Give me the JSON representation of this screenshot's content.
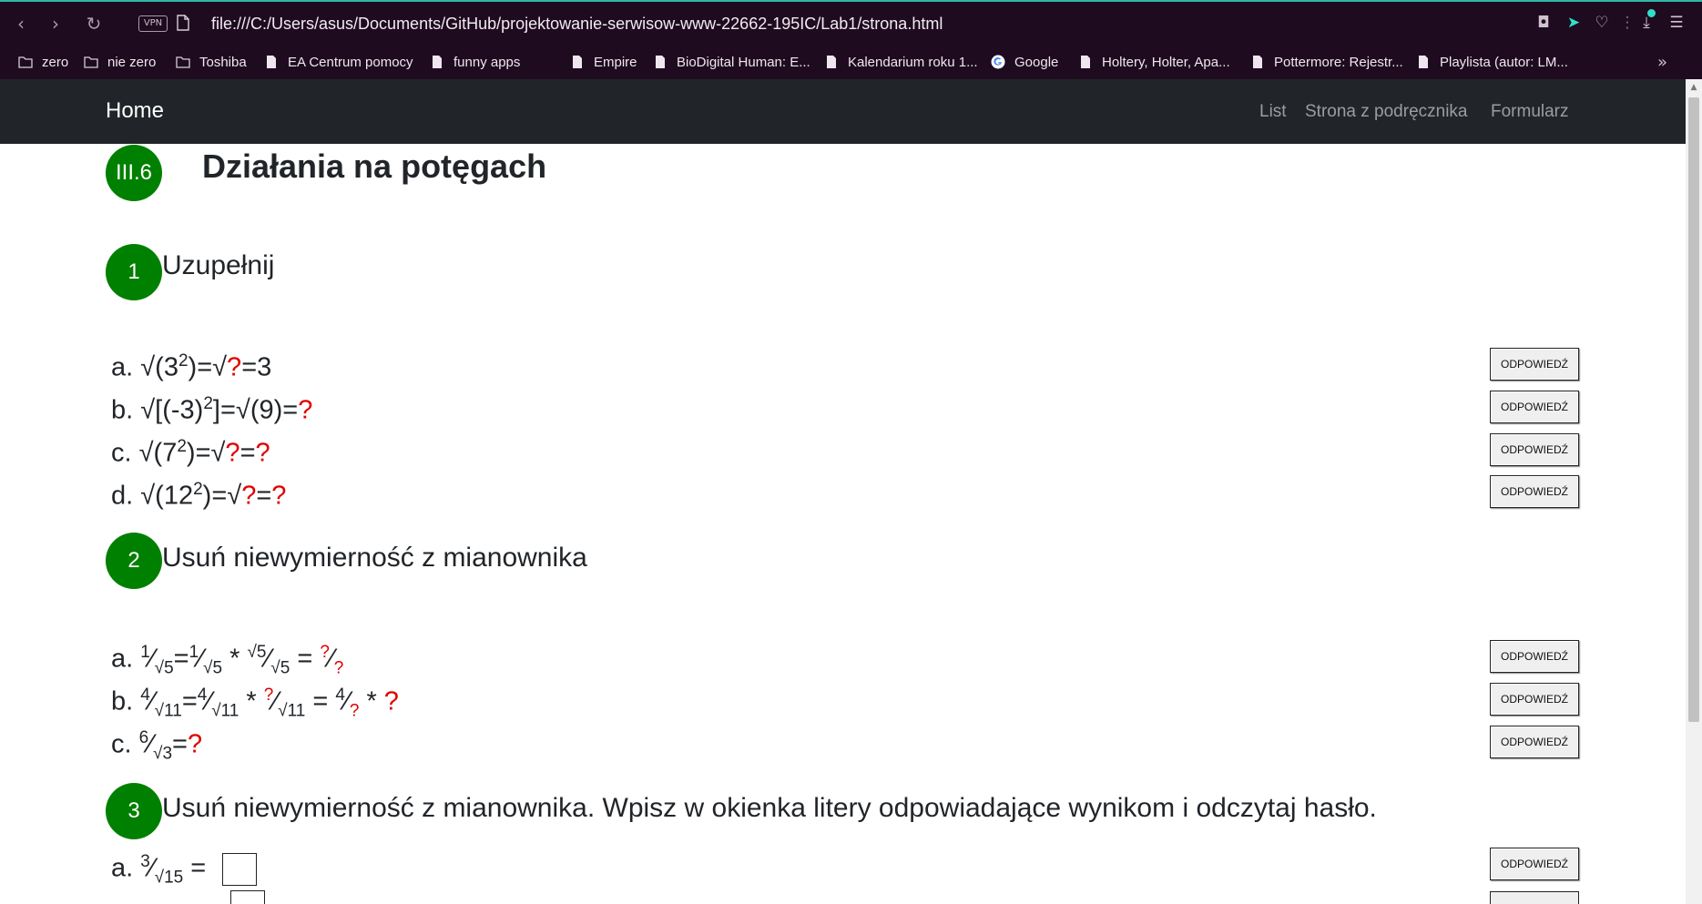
{
  "browser": {
    "url": "file:///C:/Users/asus/Documents/GitHub/projektowanie-serwisow-www-22662-195IC/Lab1/strona.html",
    "vpn_label": "VPN",
    "bookmarks": [
      {
        "label": "zero",
        "icon": "folder-icon"
      },
      {
        "label": "nie zero",
        "icon": "folder-icon"
      },
      {
        "label": "Toshiba",
        "icon": "folder-icon"
      },
      {
        "label": "EA Centrum pomocy",
        "icon": "page-icon"
      },
      {
        "label": "funny apps",
        "icon": "page-icon"
      },
      {
        "label": "Empire",
        "icon": "page-icon"
      },
      {
        "label": "BioDigital Human: E...",
        "icon": "page-icon"
      },
      {
        "label": "Kalendarium roku 1...",
        "icon": "page-icon"
      },
      {
        "label": "Google",
        "icon": "google-icon"
      },
      {
        "label": "Holtery, Holter, Apa...",
        "icon": "page-icon"
      },
      {
        "label": "Pottermore: Rejestr...",
        "icon": "page-icon"
      },
      {
        "label": "Playlista (autor: LM...",
        "icon": "page-icon"
      }
    ],
    "more_label": "»",
    "accent": "#2fe0c9"
  },
  "navbar": {
    "brand": "Home",
    "links": [
      "List",
      "Strona z podręcznika",
      "Formularz"
    ]
  },
  "page": {
    "chapter_badge": "III.6",
    "title": "Działania na potęgach",
    "accent_color": "#008000",
    "question_color": "#e00000",
    "answer_label": "ODPOWIEDŹ",
    "sections": [
      {
        "number": "1",
        "title": "Uzupełnij",
        "items": [
          {
            "letter": "a.",
            "parts": [
              "√(3",
              "2",
              ")=√",
              "?",
              "=3"
            ]
          },
          {
            "letter": "b.",
            "parts": [
              "√[(-3)",
              "2",
              "]=√(9)=",
              "?"
            ]
          },
          {
            "letter": "c.",
            "parts": [
              "√(7",
              "2",
              ")=√",
              "?",
              "=",
              "?"
            ]
          },
          {
            "letter": "d.",
            "parts": [
              "√(12",
              "2",
              ")=√",
              "?",
              "=",
              "?"
            ]
          }
        ]
      },
      {
        "number": "2",
        "title": "Usuń niewymierność z mianownika",
        "items": [
          {
            "letter": "a.",
            "parts": [
              "1",
              "√5",
              "=",
              "1",
              "√5",
              " * ",
              "√5",
              "√5",
              " = ",
              "?",
              "?"
            ]
          },
          {
            "letter": "b.",
            "parts": [
              "4",
              "√11",
              "=",
              "4",
              "√11",
              " * ",
              "?",
              "√11",
              " = ",
              "4",
              "?",
              " * ",
              "?"
            ]
          },
          {
            "letter": "c.",
            "parts": [
              "6",
              "√3",
              "=",
              "?"
            ]
          }
        ]
      },
      {
        "number": "3",
        "title": "Usuń niewymierność z mianownika. Wpisz w okienka litery odpowiadające wynikom i odczytaj hasło.",
        "items": [
          {
            "letter": "a.",
            "parts": [
              "3",
              "√15",
              " = "
            ]
          }
        ]
      }
    ]
  }
}
